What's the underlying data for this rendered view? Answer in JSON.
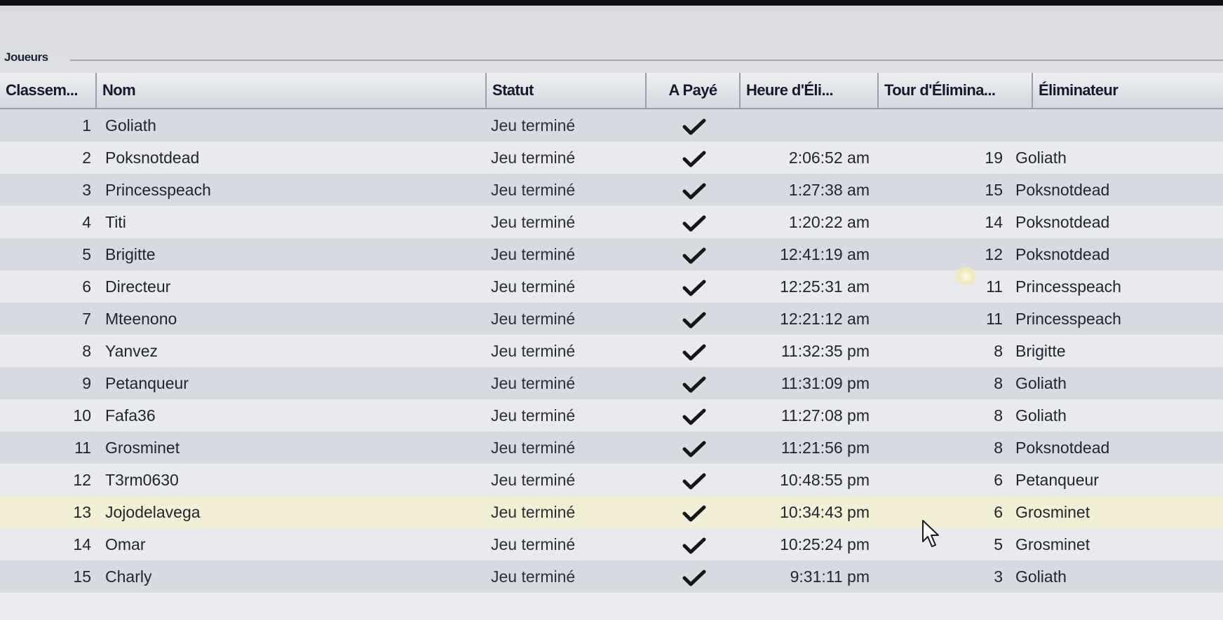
{
  "group": {
    "title": "Joueurs"
  },
  "columns": {
    "rank": "Classem...",
    "name": "Nom",
    "status": "Statut",
    "paid": "A Payé",
    "time": "Heure d'Éli...",
    "round": "Tour d'Élimina...",
    "eliminator": "Éliminateur"
  },
  "players": [
    {
      "rank": "1",
      "name": "Goliath",
      "status": "Jeu terminé",
      "paid": true,
      "time": "",
      "round": "",
      "eliminator": ""
    },
    {
      "rank": "2",
      "name": "Poksnotdead",
      "status": "Jeu terminé",
      "paid": true,
      "time": "2:06:52 am",
      "round": "19",
      "eliminator": "Goliath"
    },
    {
      "rank": "3",
      "name": "Princesspeach",
      "status": "Jeu terminé",
      "paid": true,
      "time": "1:27:38 am",
      "round": "15",
      "eliminator": "Poksnotdead"
    },
    {
      "rank": "4",
      "name": "Titi",
      "status": "Jeu terminé",
      "paid": true,
      "time": "1:20:22 am",
      "round": "14",
      "eliminator": "Poksnotdead"
    },
    {
      "rank": "5",
      "name": "Brigitte",
      "status": "Jeu terminé",
      "paid": true,
      "time": "12:41:19 am",
      "round": "12",
      "eliminator": "Poksnotdead"
    },
    {
      "rank": "6",
      "name": "Directeur",
      "status": "Jeu terminé",
      "paid": true,
      "time": "12:25:31 am",
      "round": "11",
      "eliminator": "Princesspeach"
    },
    {
      "rank": "7",
      "name": "Mteenono",
      "status": "Jeu terminé",
      "paid": true,
      "time": "12:21:12 am",
      "round": "11",
      "eliminator": "Princesspeach"
    },
    {
      "rank": "8",
      "name": "Yanvez",
      "status": "Jeu terminé",
      "paid": true,
      "time": "11:32:35 pm",
      "round": "8",
      "eliminator": "Brigitte"
    },
    {
      "rank": "9",
      "name": "Petanqueur",
      "status": "Jeu terminé",
      "paid": true,
      "time": "11:31:09 pm",
      "round": "8",
      "eliminator": "Goliath"
    },
    {
      "rank": "10",
      "name": "Fafa36",
      "status": "Jeu terminé",
      "paid": true,
      "time": "11:27:08 pm",
      "round": "8",
      "eliminator": "Goliath"
    },
    {
      "rank": "11",
      "name": "Grosminet",
      "status": "Jeu terminé",
      "paid": true,
      "time": "11:21:56 pm",
      "round": "8",
      "eliminator": "Poksnotdead"
    },
    {
      "rank": "12",
      "name": "T3rm0630",
      "status": "Jeu terminé",
      "paid": true,
      "time": "10:48:55 pm",
      "round": "6",
      "eliminator": "Petanqueur"
    },
    {
      "rank": "13",
      "name": "Jojodelavega",
      "status": "Jeu terminé",
      "paid": true,
      "time": "10:34:43 pm",
      "round": "6",
      "eliminator": "Grosminet",
      "selected": true
    },
    {
      "rank": "14",
      "name": "Omar",
      "status": "Jeu terminé",
      "paid": true,
      "time": "10:25:24 pm",
      "round": "5",
      "eliminator": "Grosminet"
    },
    {
      "rank": "15",
      "name": "Charly",
      "status": "Jeu terminé",
      "paid": true,
      "time": "9:31:11 pm",
      "round": "3",
      "eliminator": "Goliath"
    }
  ],
  "icons": {
    "paid": "checkmark-icon",
    "cursor": "mouse-pointer-icon"
  },
  "colors": {
    "selected_row": "#f3efd6",
    "row_alt": "#d7dae0",
    "row_plain": "#e8eaee"
  }
}
